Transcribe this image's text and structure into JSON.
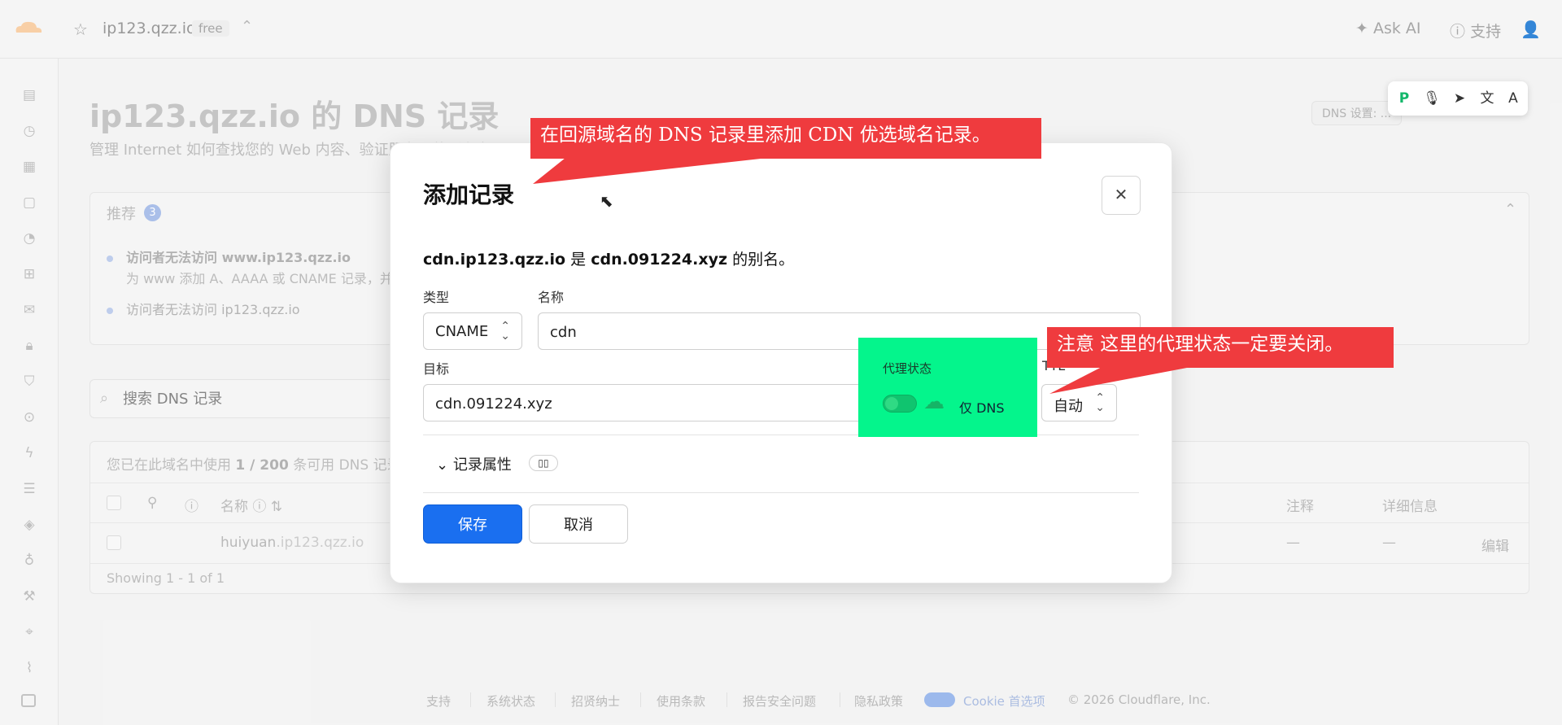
{
  "topbar": {
    "domain": "ip123.qzz.io",
    "plan": "free",
    "ask_ai": "Ask AI",
    "support": "支持"
  },
  "page": {
    "title": "ip123.qzz.io 的 DNS 记录",
    "subtitle": "管理 Internet 如何查找您的 Web 内容、验证服务器的所有者 ...",
    "dns_settings": "DNS 设置: ..."
  },
  "recommendations": {
    "title": "推荐",
    "count": "3",
    "items": [
      {
        "title": "访问者无法访问 www.ip123.qzz.io",
        "sub": "为 www 添加 A、AAAA 或 CNAME 记录，并 ..."
      },
      {
        "title": "访问者无法访问 ip123.qzz.io",
        "sub": ""
      }
    ]
  },
  "search": {
    "placeholder": "搜索 DNS 记录"
  },
  "table": {
    "usage_prefix": "您已在此域名中使用",
    "usage_count": "1 / 200",
    "usage_suffix": "条可用 DNS 记录",
    "columns": {
      "name": "名称",
      "notes": "注释",
      "details": "详细信息"
    },
    "row": {
      "name_sub": "huiyuan",
      "name_domain": ".ip123.qzz.io",
      "notes": "—",
      "details": "—",
      "edit": "编辑"
    },
    "showing": "Showing 1 - 1 of 1"
  },
  "modal": {
    "title": "添加记录",
    "alias_a": "cdn.ip123.qzz.io",
    "alias_is": " 是 ",
    "alias_b": "cdn.091224.xyz",
    "alias_end": " 的别名。",
    "type_label": "类型",
    "type_value": "CNAME",
    "name_label": "名称",
    "name_value": "cdn",
    "target_label": "目标",
    "target_value": "cdn.091224.xyz",
    "proxy_label": "代理状态",
    "proxy_value": "仅 DNS",
    "ttl_label": "TTL",
    "ttl_value": "自动",
    "record_props": "记录属性",
    "save": "保存",
    "cancel": "取消"
  },
  "annotations": {
    "callout_1": "在回源域名的 DNS 记录里添加 CDN 优选域名记录。",
    "callout_2": "注意 这里的代理状态一定要关闭。"
  },
  "footer": {
    "links": [
      "支持",
      "系统状态",
      "招贤纳士",
      "使用条款",
      "报告安全问题",
      "隐私政策"
    ],
    "cookie": "Cookie 首选项",
    "copyright": "© 2026 Cloudflare, Inc."
  },
  "colors": {
    "primary": "#1a6ff0",
    "callout": "#ef3b3e",
    "highlight": "#04f58c"
  }
}
